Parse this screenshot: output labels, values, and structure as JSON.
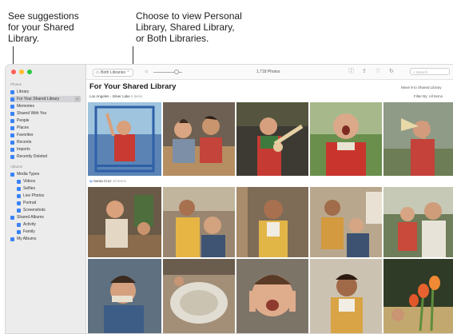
{
  "callouts": {
    "suggestions": "See suggestions\nfor your Shared\nLibrary.",
    "choose": "Choose to view Personal\nLibrary, Shared Library,\nor Both Libraries."
  },
  "toolbar": {
    "library_label": "Both Libraries",
    "photo_count": "1,718 Photos",
    "search_placeholder": "Search"
  },
  "sidebar": {
    "section_photos": "Photos",
    "section_albums": "Albums",
    "items": [
      {
        "label": "Library"
      },
      {
        "label": "For Your Shared Library",
        "count": "42"
      },
      {
        "label": "Memories"
      },
      {
        "label": "Shared With You"
      },
      {
        "label": "People"
      },
      {
        "label": "Places"
      },
      {
        "label": "Favorites"
      },
      {
        "label": "Recents"
      },
      {
        "label": "Imports"
      },
      {
        "label": "Recently Deleted"
      }
    ],
    "album_items": [
      {
        "label": "Media Types"
      },
      {
        "label": "Videos"
      },
      {
        "label": "Selfies"
      },
      {
        "label": "Live Photos"
      },
      {
        "label": "Portrait"
      },
      {
        "label": "Screenshots"
      },
      {
        "label": "Shared Albums"
      },
      {
        "label": "Activity"
      },
      {
        "label": "Family"
      },
      {
        "label": "My Albums"
      }
    ]
  },
  "main": {
    "title": "For Your Shared Library",
    "group1_location": "Los Angeles - Silver Lake",
    "group1_meta": "5 items",
    "group2_location": "Santa Cruz",
    "group2_meta": "10 items",
    "move_link": "Move 9 to Shared Library",
    "filter_link": "Filter By: All Items"
  },
  "colors": {
    "accent": "#3a82f7",
    "traffic_red": "#ff5f57",
    "traffic_yellow": "#febc2e",
    "traffic_green": "#28c840"
  }
}
